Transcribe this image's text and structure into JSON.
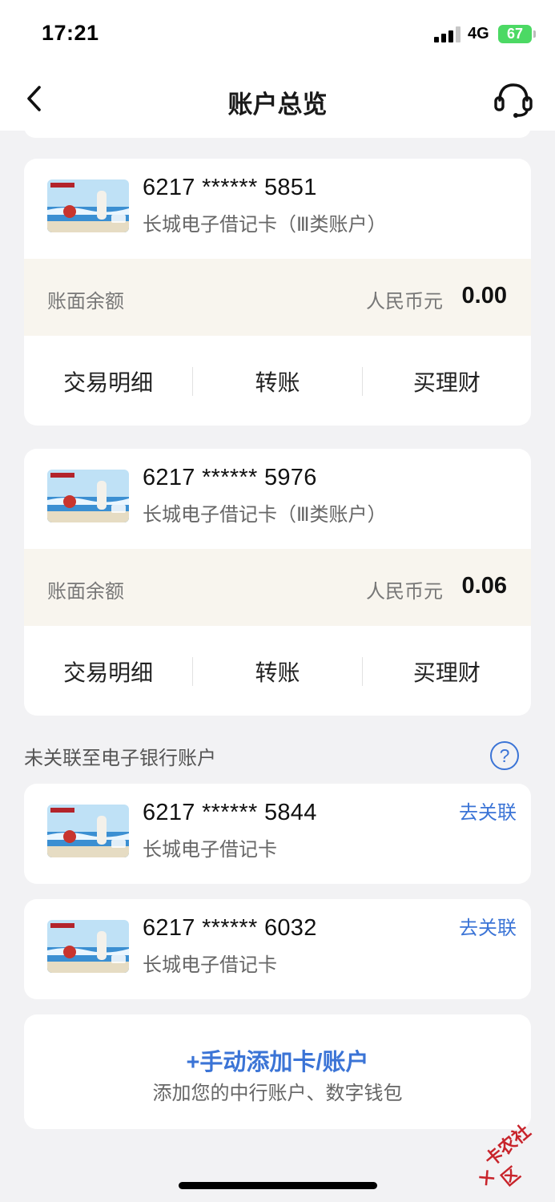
{
  "status_bar": {
    "time": "17:21",
    "network": "4G",
    "battery": "67"
  },
  "nav": {
    "title": "账户总览"
  },
  "linked_cards": [
    {
      "number": "6217 ****** 5851",
      "type": "长城电子借记卡（Ⅲ类账户）",
      "balance_label": "账面余额",
      "currency": "人民币元",
      "amount": "0.00",
      "actions": [
        "交易明细",
        "转账",
        "买理财"
      ]
    },
    {
      "number": "6217 ****** 5976",
      "type": "长城电子借记卡（Ⅲ类账户）",
      "balance_label": "账面余额",
      "currency": "人民币元",
      "amount": "0.06",
      "actions": [
        "交易明细",
        "转账",
        "买理财"
      ]
    }
  ],
  "unlinked_section": {
    "title": "未关联至电子银行账户",
    "help": "?"
  },
  "unlinked_cards": [
    {
      "number": "6217 ****** 5844",
      "type": "长城电子借记卡",
      "link_label": "去关联"
    },
    {
      "number": "6217 ****** 6032",
      "type": "长城电子借记卡",
      "link_label": "去关联"
    }
  ],
  "add_card": {
    "title": "+手动添加卡/账户",
    "subtitle": "添加您的中行账户、数字钱包"
  },
  "watermark": {
    "text": "卡农社区"
  },
  "colors": {
    "accent": "#3b74d6",
    "balance_bg": "#f8f5ee",
    "page_bg": "#f2f2f4",
    "battery": "#4cd964"
  }
}
